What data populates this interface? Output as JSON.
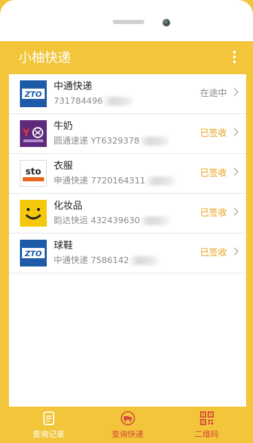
{
  "app": {
    "title": "小柚快递"
  },
  "colors": {
    "accent": "#f2c53a",
    "signed": "#e8a21b",
    "active_tab": "#d6463a"
  },
  "list": [
    {
      "name": "中通快递",
      "number": "731784496",
      "status": "在途中",
      "status_type": "transit",
      "logo": "zto-logo-icon"
    },
    {
      "name": "牛奶",
      "number": "圆通速递 YT6329378",
      "status": "已签收",
      "status_type": "signed",
      "logo": "yto-logo-icon"
    },
    {
      "name": "衣服",
      "number": "申通快递 7720164311",
      "status": "已签收",
      "status_type": "signed",
      "logo": "sto-logo-icon"
    },
    {
      "name": "化妆品",
      "number": "韵达快运 432439630",
      "status": "已签收",
      "status_type": "signed",
      "logo": "yunda-logo-icon"
    },
    {
      "name": "球鞋",
      "number": "中通快递 7586142",
      "status": "已签收",
      "status_type": "signed",
      "logo": "zto-logo-icon"
    }
  ],
  "bottom_nav": [
    {
      "label": "查询记录",
      "icon": "record-list-icon",
      "active": false
    },
    {
      "label": "查询快递",
      "icon": "delivery-truck-icon",
      "active": true
    },
    {
      "label": "二维码",
      "icon": "qr-code-icon",
      "active": false
    }
  ]
}
